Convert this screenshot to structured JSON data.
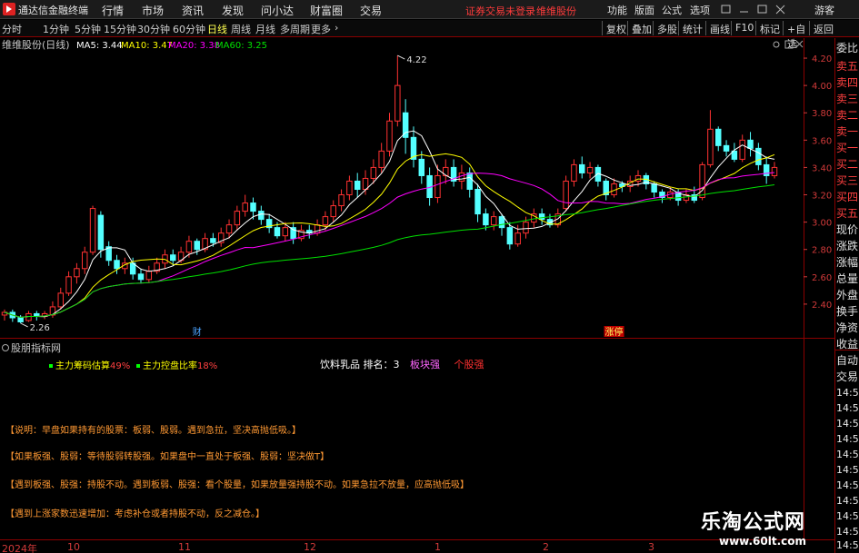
{
  "app": {
    "title": "通达信金融终端"
  },
  "menu": {
    "items": [
      "行情",
      "市场",
      "资讯",
      "发现",
      "问小达",
      "财富圈",
      "交易"
    ],
    "warning": "证券交易未登录",
    "stock": "维维股份",
    "right_items": [
      "功能",
      "版面",
      "公式",
      "选项"
    ],
    "guest": "游客"
  },
  "toolbar": {
    "periods": [
      "分时",
      "1分钟",
      "5分钟",
      "15分钟",
      "30分钟",
      "60分钟",
      "日线",
      "周线",
      "月线",
      "多周期",
      "更多"
    ],
    "active_period": "日线",
    "right_buttons": [
      "复权",
      "叠加",
      "多股",
      "统计",
      "画线",
      "F10",
      "标记",
      "+自选",
      "返回"
    ]
  },
  "chart_header": {
    "name": "维维股份(日线)",
    "ma5": "MA5: 3.44",
    "ma10": "MA10: 3.47",
    "ma20": "MA20: 3.38",
    "ma60": "MA60: 3.25"
  },
  "colors": {
    "up": "#ff3232",
    "down": "#54ffff",
    "ma5": "#ffffff",
    "ma10": "#ffff00",
    "ma20": "#ff00ff",
    "ma60": "#00e000",
    "axis_text": "#d23a3a"
  },
  "annotations": {
    "high": "4.22",
    "low": "2.26",
    "tag_cai": "财",
    "tag_zhangting": "涨停"
  },
  "indicator": {
    "name": "股朋指标网",
    "line1_label": "主力筹码估算",
    "line1_value": "49%",
    "line2_label": "主力控盘比率",
    "line2_value": "18%",
    "sector_label": "饮料乳品 排名：",
    "sector_rank": "3",
    "sector_status": "板块强",
    "stock_status": "个股强"
  },
  "notes": [
    "【说明：早盘如果持有的股票：板弱、股弱。遇到急拉，坚决高抛低吸。】",
    "【如果板强、股弱：等待股弱转股强。如果盘中一直处于板强、股弱：坚决做T】",
    "【遇到板强、股强：持股不动。遇到板弱、股强：看个股量，如果放量强持股不动。如果急拉不放量，应高抛低吸】",
    "【遇到上涨家数迅速增加：考虑补仓或者持股不动，反之减仓。】"
  ],
  "sidebar": {
    "labels": [
      "委比",
      "卖五",
      "卖四",
      "卖三",
      "卖二",
      "卖一",
      "买一",
      "买二",
      "买三",
      "买四",
      "买五",
      "现价",
      "涨跌",
      "涨幅",
      "总量",
      "外盘",
      "换手",
      "净资",
      "收益"
    ],
    "trade_tabs": [
      "自动",
      "交易"
    ],
    "times": [
      "14:5",
      "14:5",
      "14:5",
      "14:5",
      "14:5",
      "14:5",
      "14:5",
      "14:5",
      "14:5",
      "14:5",
      "14:5"
    ]
  },
  "x_axis": {
    "labels": [
      "2024年",
      "10",
      "11",
      "12",
      "1",
      "2",
      "3"
    ]
  },
  "watermark": {
    "text": "乐淘公式网",
    "url": "www.60lt.com"
  },
  "chart_data": {
    "type": "candlestick",
    "title": "维维股份(日线)",
    "y_ticks": [
      2.4,
      2.6,
      2.8,
      3.0,
      3.2,
      3.4,
      3.6,
      3.8,
      4.0,
      4.2
    ],
    "ylim": [
      2.22,
      4.28
    ],
    "high_label": 4.22,
    "low_label": 2.26,
    "candles": [
      [
        2.32,
        2.34,
        2.28,
        2.36
      ],
      [
        2.34,
        2.3,
        2.27,
        2.36
      ],
      [
        2.3,
        2.27,
        2.26,
        2.32
      ],
      [
        2.28,
        2.33,
        2.27,
        2.35
      ],
      [
        2.33,
        2.31,
        2.28,
        2.35
      ],
      [
        2.31,
        2.33,
        2.29,
        2.35
      ],
      [
        2.32,
        2.38,
        2.3,
        2.42
      ],
      [
        2.38,
        2.48,
        2.36,
        2.52
      ],
      [
        2.48,
        2.6,
        2.46,
        2.64
      ],
      [
        2.6,
        2.66,
        2.55,
        2.7
      ],
      [
        2.66,
        2.78,
        2.62,
        2.82
      ],
      [
        2.78,
        3.1,
        2.76,
        3.12
      ],
      [
        3.05,
        2.8,
        2.74,
        3.08
      ],
      [
        2.82,
        2.72,
        2.68,
        2.86
      ],
      [
        2.72,
        2.66,
        2.62,
        2.76
      ],
      [
        2.66,
        2.7,
        2.62,
        2.74
      ],
      [
        2.7,
        2.62,
        2.58,
        2.74
      ],
      [
        2.62,
        2.58,
        2.55,
        2.66
      ],
      [
        2.58,
        2.64,
        2.56,
        2.68
      ],
      [
        2.64,
        2.7,
        2.62,
        2.74
      ],
      [
        2.7,
        2.76,
        2.66,
        2.8
      ],
      [
        2.76,
        2.72,
        2.68,
        2.8
      ],
      [
        2.72,
        2.78,
        2.7,
        2.82
      ],
      [
        2.78,
        2.86,
        2.74,
        2.9
      ],
      [
        2.86,
        2.8,
        2.76,
        2.88
      ],
      [
        2.8,
        2.88,
        2.78,
        2.92
      ],
      [
        2.88,
        2.85,
        2.82,
        2.92
      ],
      [
        2.85,
        2.92,
        2.82,
        2.96
      ],
      [
        2.92,
        2.98,
        2.88,
        3.02
      ],
      [
        2.98,
        3.08,
        2.94,
        3.12
      ],
      [
        3.08,
        3.14,
        3.04,
        3.2
      ],
      [
        3.14,
        3.08,
        3.02,
        3.18
      ],
      [
        3.08,
        3.02,
        2.98,
        3.12
      ],
      [
        3.02,
        2.96,
        2.92,
        3.06
      ],
      [
        2.96,
        2.9,
        2.88,
        3.0
      ],
      [
        2.9,
        2.96,
        2.86,
        3.0
      ],
      [
        2.96,
        2.88,
        2.84,
        3.0
      ],
      [
        2.88,
        2.94,
        2.86,
        2.98
      ],
      [
        2.94,
        2.92,
        2.88,
        2.98
      ],
      [
        2.92,
        2.98,
        2.9,
        3.02
      ],
      [
        2.98,
        3.04,
        2.94,
        3.08
      ],
      [
        3.04,
        3.12,
        3.0,
        3.16
      ],
      [
        3.12,
        3.2,
        3.08,
        3.24
      ],
      [
        3.2,
        3.3,
        3.16,
        3.34
      ],
      [
        3.3,
        3.24,
        3.18,
        3.36
      ],
      [
        3.24,
        3.32,
        3.2,
        3.38
      ],
      [
        3.32,
        3.4,
        3.28,
        3.46
      ],
      [
        3.4,
        3.52,
        3.36,
        3.58
      ],
      [
        3.52,
        3.74,
        3.48,
        3.8
      ],
      [
        3.74,
        4.0,
        3.7,
        4.22
      ],
      [
        3.8,
        3.62,
        3.5,
        3.9
      ],
      [
        3.62,
        3.46,
        3.4,
        3.7
      ],
      [
        3.46,
        3.34,
        3.28,
        3.52
      ],
      [
        3.34,
        3.18,
        3.12,
        3.4
      ],
      [
        3.18,
        3.34,
        3.14,
        3.42
      ],
      [
        3.34,
        3.4,
        3.28,
        3.46
      ],
      [
        3.4,
        3.3,
        3.26,
        3.46
      ],
      [
        3.3,
        3.36,
        3.24,
        3.42
      ],
      [
        3.36,
        3.24,
        3.18,
        3.4
      ],
      [
        3.24,
        3.06,
        3.0,
        3.28
      ],
      [
        3.06,
        2.98,
        2.94,
        3.1
      ],
      [
        2.98,
        3.04,
        2.94,
        3.08
      ],
      [
        3.04,
        2.96,
        2.9,
        3.06
      ],
      [
        2.96,
        2.84,
        2.8,
        3.0
      ],
      [
        2.84,
        2.92,
        2.82,
        2.98
      ],
      [
        2.92,
        3.0,
        2.88,
        3.04
      ],
      [
        3.0,
        3.06,
        2.96,
        3.1
      ],
      [
        3.06,
        3.02,
        2.98,
        3.1
      ],
      [
        3.02,
        2.98,
        2.96,
        3.06
      ],
      [
        2.98,
        3.06,
        2.96,
        3.1
      ],
      [
        3.1,
        3.3,
        3.08,
        3.34
      ],
      [
        3.3,
        3.42,
        3.26,
        3.46
      ],
      [
        3.42,
        3.36,
        3.32,
        3.48
      ],
      [
        3.36,
        3.4,
        3.32,
        3.44
      ],
      [
        3.4,
        3.3,
        3.26,
        3.42
      ],
      [
        3.3,
        3.2,
        3.16,
        3.32
      ],
      [
        3.2,
        3.28,
        3.18,
        3.32
      ],
      [
        3.28,
        3.26,
        3.22,
        3.3
      ],
      [
        3.26,
        3.3,
        3.22,
        3.34
      ],
      [
        3.3,
        3.34,
        3.26,
        3.38
      ],
      [
        3.34,
        3.28,
        3.24,
        3.36
      ],
      [
        3.28,
        3.22,
        3.18,
        3.3
      ],
      [
        3.22,
        3.18,
        3.14,
        3.24
      ],
      [
        3.18,
        3.22,
        3.16,
        3.26
      ],
      [
        3.22,
        3.16,
        3.12,
        3.24
      ],
      [
        3.16,
        3.2,
        3.14,
        3.24
      ],
      [
        3.2,
        3.16,
        3.14,
        3.26
      ],
      [
        3.18,
        3.42,
        3.16,
        3.44
      ],
      [
        3.42,
        3.68,
        3.4,
        3.82
      ],
      [
        3.68,
        3.56,
        3.52,
        3.7
      ],
      [
        3.56,
        3.52,
        3.48,
        3.6
      ],
      [
        3.52,
        3.46,
        3.44,
        3.58
      ],
      [
        3.46,
        3.6,
        3.44,
        3.64
      ],
      [
        3.6,
        3.54,
        3.48,
        3.66
      ],
      [
        3.54,
        3.42,
        3.38,
        3.58
      ],
      [
        3.42,
        3.34,
        3.28,
        3.48
      ],
      [
        3.34,
        3.4,
        3.32,
        3.44
      ]
    ],
    "markers": [
      {
        "label": "财",
        "index": 24
      },
      {
        "label": "涨停",
        "index": 76
      }
    ]
  }
}
